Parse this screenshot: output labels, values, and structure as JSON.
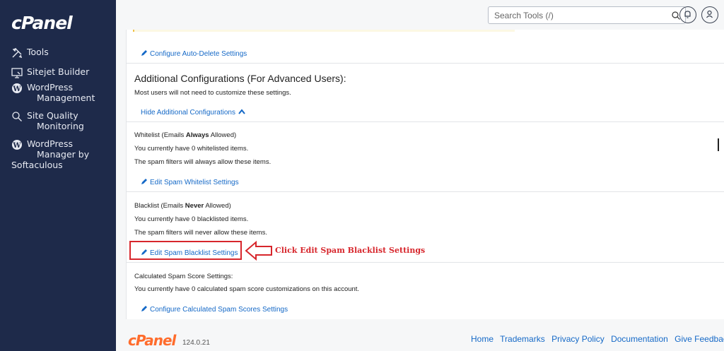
{
  "sidebar": {
    "logo": "cPanel",
    "items": [
      {
        "label": "Tools",
        "icon": "tools-icon"
      },
      {
        "label": "Sitejet Builder",
        "icon": "monitor-icon"
      },
      {
        "label_l1": "WordPress",
        "label_l2": "Management",
        "icon": "wordpress-icon"
      },
      {
        "label_l1": "Site Quality",
        "label_l2": "Monitoring",
        "icon": "search-magnify-icon"
      },
      {
        "label_l1": "WordPress",
        "label_l2": "Manager by",
        "label_l3": "Softaculous",
        "icon": "wordpress-icon"
      }
    ]
  },
  "topbar": {
    "search_placeholder": "Search Tools (/)",
    "bell": "notifications",
    "user": "user"
  },
  "content": {
    "auto_delete_link": "Configure Auto-Delete Settings",
    "advanced_title": "Additional Configurations (For Advanced Users):",
    "advanced_desc": "Most users will not need to customize these settings.",
    "hide_link": "Hide Additional Configurations",
    "whitelist": {
      "title_pre": "Whitelist (Emails ",
      "title_bold": "Always",
      "title_post": " Allowed)",
      "line1": "You currently have 0 whitelisted items.",
      "line2": "The spam filters will always allow these items.",
      "link": "Edit Spam Whitelist Settings"
    },
    "blacklist": {
      "title_pre": "Blacklist (Emails ",
      "title_bold": "Never",
      "title_post": " Allowed)",
      "line1": "You currently have 0 blacklisted items.",
      "line2": "The spam filters will never allow these items.",
      "link": "Edit Spam Blacklist Settings"
    },
    "score": {
      "title": "Calculated Spam Score Settings:",
      "line1": "You currently have 0 calculated spam score customizations on this account.",
      "link": "Configure Calculated Spam Scores Settings"
    },
    "annotation": "Click Edit Spam Blacklist Settings"
  },
  "footer": {
    "logo": "cPanel",
    "version": "124.0.21",
    "links": [
      "Home",
      "Trademarks",
      "Privacy Policy",
      "Documentation",
      "Give Feedback"
    ]
  },
  "colors": {
    "sidebar_bg": "#1e2a4a",
    "link": "#1569c7",
    "annotation": "#d7262c",
    "footer_logo": "#ff6c2c"
  }
}
